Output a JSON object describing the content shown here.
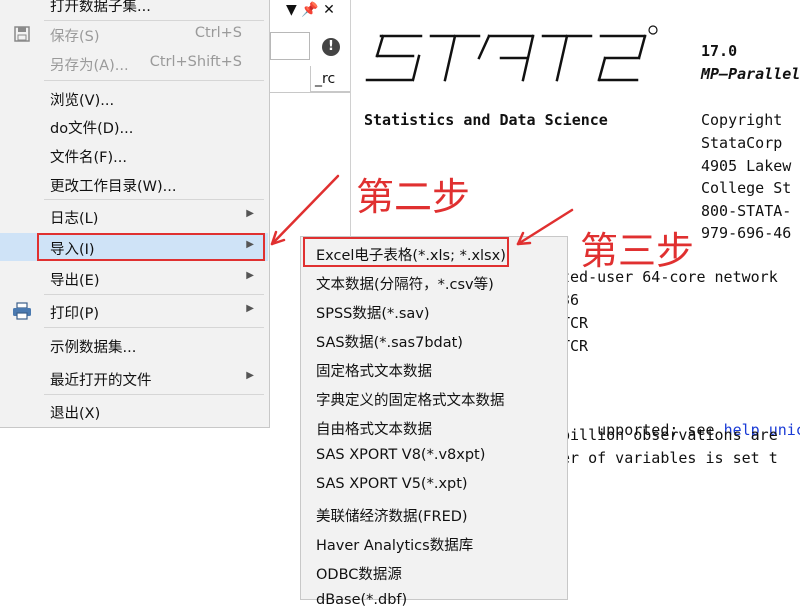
{
  "file_menu": {
    "items": [
      {
        "label": "打开数据子集...",
        "shortcut": "",
        "disabled": false,
        "submenu": false
      },
      {
        "label": "保存(S)",
        "shortcut": "Ctrl+S",
        "disabled": true,
        "submenu": false,
        "icon": "save-icon"
      },
      {
        "label": "另存为(A)...",
        "shortcut": "Ctrl+Shift+S",
        "disabled": true,
        "submenu": false
      },
      {
        "label": "浏览(V)...",
        "shortcut": "",
        "disabled": false,
        "submenu": false
      },
      {
        "label": "do文件(D)...",
        "shortcut": "",
        "disabled": false,
        "submenu": false
      },
      {
        "label": "文件名(F)...",
        "shortcut": "",
        "disabled": false,
        "submenu": false
      },
      {
        "label": "更改工作目录(W)...",
        "shortcut": "",
        "disabled": false,
        "submenu": false
      },
      {
        "label": "日志(L)",
        "shortcut": "",
        "disabled": false,
        "submenu": true
      },
      {
        "label": "导入(I)",
        "shortcut": "",
        "disabled": false,
        "submenu": true,
        "highlighted": true
      },
      {
        "label": "导出(E)",
        "shortcut": "",
        "disabled": false,
        "submenu": true
      },
      {
        "label": "打印(P)",
        "shortcut": "",
        "disabled": false,
        "submenu": true,
        "icon": "printer-icon"
      },
      {
        "label": "示例数据集...",
        "shortcut": "",
        "disabled": false,
        "submenu": false
      },
      {
        "label": "最近打开的文件",
        "shortcut": "",
        "disabled": false,
        "submenu": true
      },
      {
        "label": "退出(X)",
        "shortcut": "",
        "disabled": false,
        "submenu": false
      }
    ]
  },
  "import_submenu": {
    "items": [
      "Excel电子表格(*.xls; *.xlsx)",
      "文本数据(分隔符，*.csv等)",
      "SPSS数据(*.sav)",
      "SAS数据(*.sas7bdat)",
      "固定格式文本数据",
      "字典定义的固定格式文本数据",
      "自由格式文本数据",
      "SAS XPORT V8(*.v8xpt)",
      "SAS XPORT V5(*.xpt)",
      "美联储经济数据(FRED)",
      "Haver Analytics数据库",
      "ODBC数据源",
      "dBase(*.dbf)"
    ]
  },
  "variables_pane": {
    "pane_controls": "▼ 📌 ✕",
    "column_header": "_rc",
    "info_icon": "!"
  },
  "results": {
    "version": "17.0",
    "edition": "MP—Parallel",
    "tagline": "Statistics and Data Science",
    "copyright_lines": [
      "Copyright",
      "StataCorp",
      "4905 Lakew",
      "College St",
      "800-STATA-",
      "979-696-46"
    ],
    "license_line": "ted-user 64-core network",
    "serial_line": "36",
    "licensed_to_1": "TCR",
    "licensed_to_2": "TCR",
    "note_1_prefix": "upported; see ",
    "note_1_link": "help unico",
    "note_2": "billion observations are",
    "note_3": "er of variables is set t"
  },
  "annotations": {
    "step2": "第二步",
    "step3": "第三步",
    "color": "#e03030"
  }
}
